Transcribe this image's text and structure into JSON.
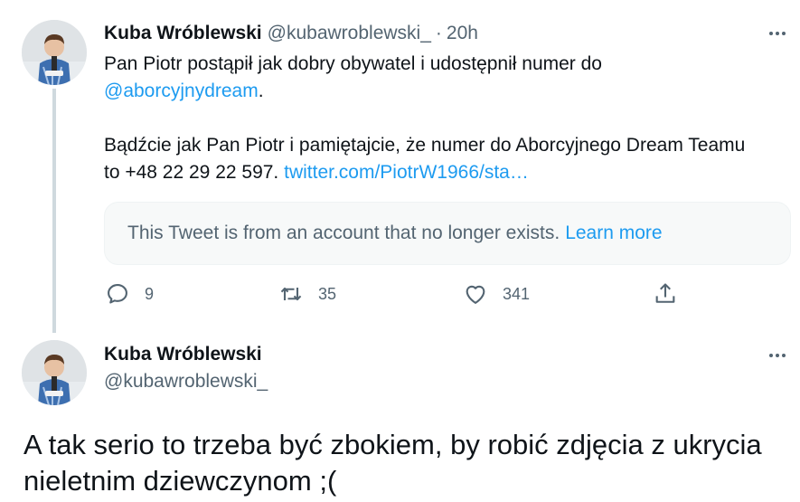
{
  "tweet1": {
    "author_name": "Kuba Wróblewski",
    "author_handle": "@kubawroblewski_",
    "separator": "·",
    "time": "20h",
    "text_line1": "Pan Piotr postąpił jak dobry obywatel i udostępnił numer do",
    "mention": "@aborcyjnydream",
    "mention_suffix": ".",
    "text_line3": "Bądźcie jak Pan Piotr i pamiętajcie, że numer do Aborcyjnego Dream Teamu",
    "text_line4": "to +48 22 29 22 597.",
    "link_text": "twitter.com/PiotrW1966/sta…",
    "quoted_notice": "This Tweet is from an account that no longer exists.",
    "learn_more": "Learn more",
    "actions": {
      "reply_count": "9",
      "retweet_count": "35",
      "like_count": "341"
    }
  },
  "tweet2": {
    "author_name": "Kuba Wróblewski",
    "author_handle": "@kubawroblewski_",
    "text": "A tak serio to trzeba być zbokiem, by robić zdjęcia z ukrycia nieletnim dziewczynom ;("
  },
  "icons": {
    "reply": "reply-icon",
    "retweet": "retweet-icon",
    "like": "heart-icon",
    "share": "share-icon",
    "more": "more-icon"
  },
  "colors": {
    "link": "#1d9bf0",
    "secondary_text": "#536471",
    "primary_text": "#0f1419",
    "notice_bg": "#f7f9f9"
  }
}
